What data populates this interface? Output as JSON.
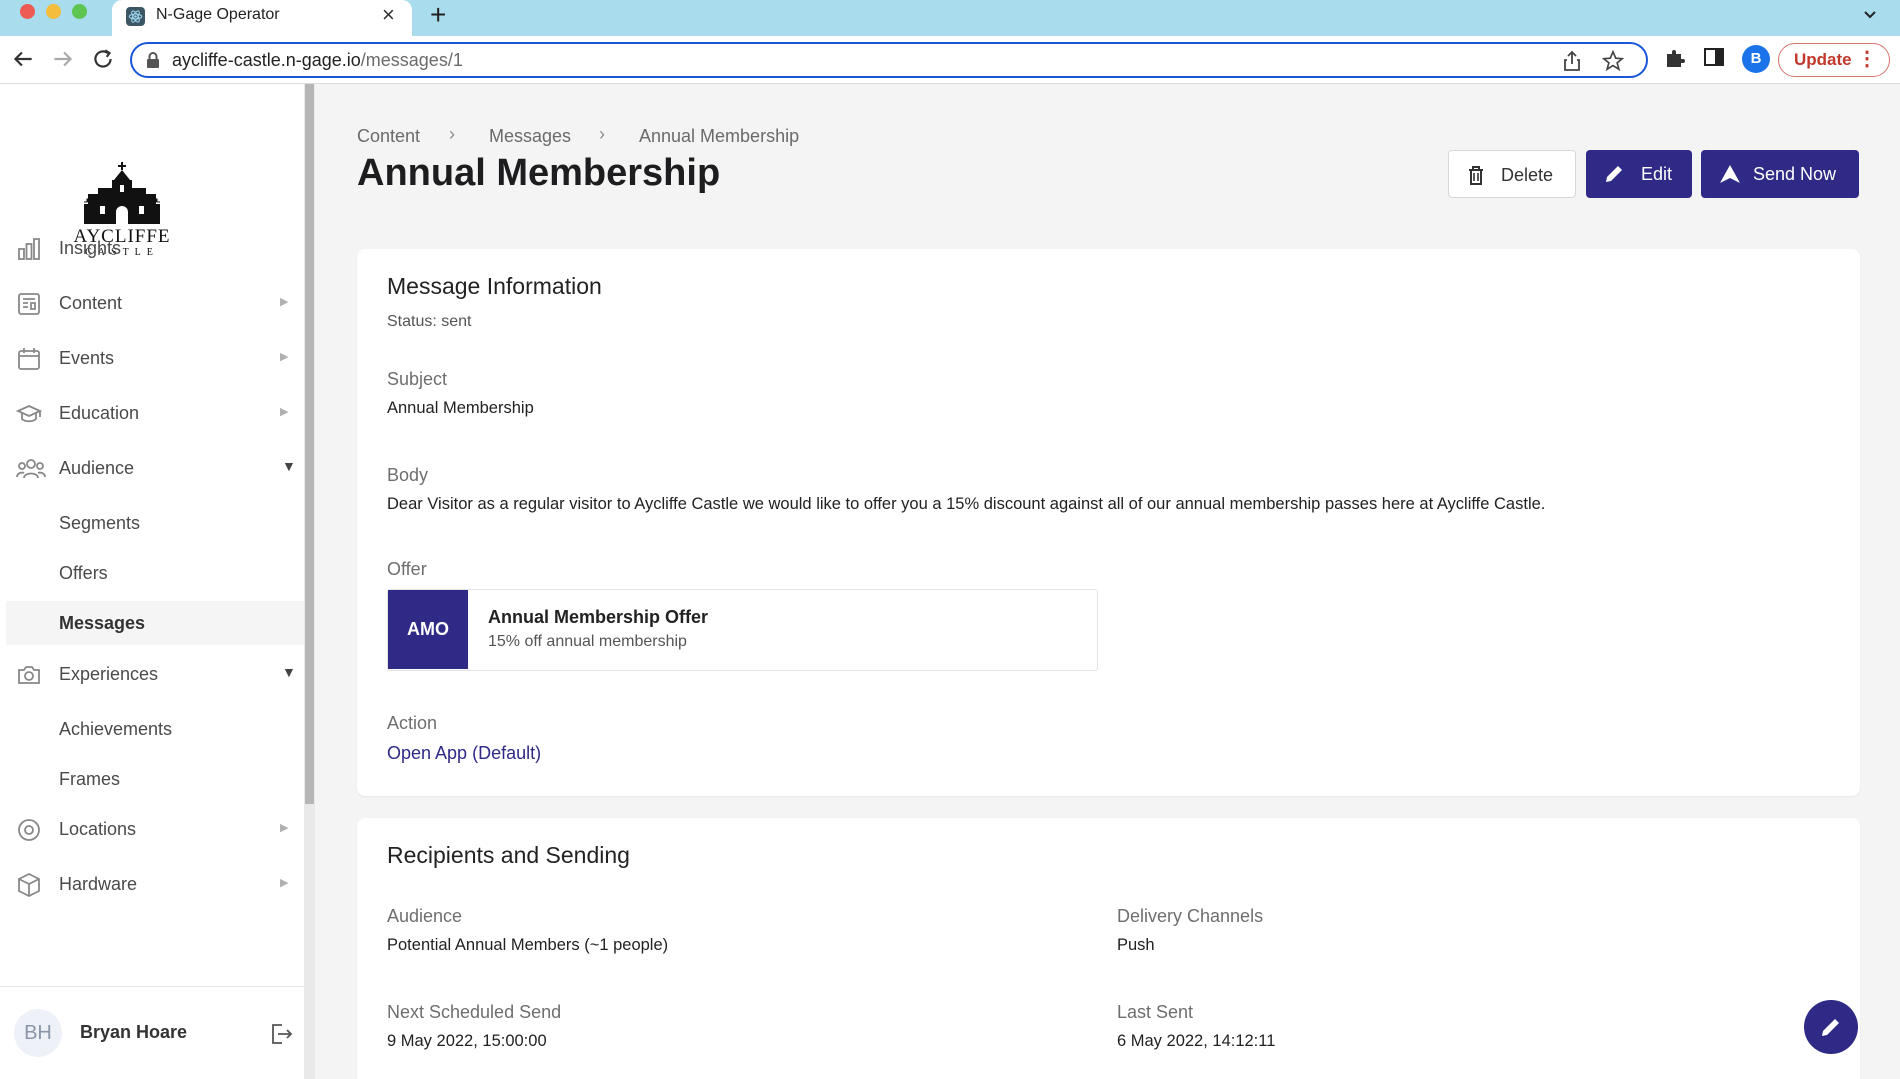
{
  "browser": {
    "tab_title": "N-Gage Operator",
    "tab_close": "×",
    "new_tab": "+",
    "url_host": "aycliffe-castle.n-gage.io",
    "url_path": "/messages/1",
    "profile_initial": "B",
    "update_label": "Update",
    "update_menu": "⋮"
  },
  "sidebar": {
    "logo_text": "AYCLIFFE",
    "logo_sub": "CASTLE",
    "items": [
      {
        "label": "Insights",
        "icon": "bar-chart-icon",
        "arrow": ""
      },
      {
        "label": "Content",
        "icon": "newspaper-icon",
        "arrow": "▶"
      },
      {
        "label": "Events",
        "icon": "calendar-icon",
        "arrow": "▶"
      },
      {
        "label": "Education",
        "icon": "graduation-cap-icon",
        "arrow": "▶"
      },
      {
        "label": "Audience",
        "icon": "users-icon",
        "arrow": "▼"
      },
      {
        "label": "Experiences",
        "icon": "camera-icon",
        "arrow": "▼"
      },
      {
        "label": "Locations",
        "icon": "map-pin-icon",
        "arrow": "▶"
      },
      {
        "label": "Hardware",
        "icon": "box-icon",
        "arrow": "▶"
      }
    ],
    "audience_sub": [
      "Segments",
      "Offers",
      "Messages"
    ],
    "experiences_sub": [
      "Achievements",
      "Frames"
    ],
    "user": {
      "initials": "BH",
      "name": "Bryan Hoare"
    }
  },
  "breadcrumb": [
    "Content",
    "Messages",
    "Annual Membership"
  ],
  "breadcrumb_sep": "›",
  "page_title": "Annual Membership",
  "actions": {
    "delete": "Delete",
    "edit": "Edit",
    "send": "Send Now"
  },
  "message_info": {
    "title": "Message Information",
    "status": "Status: sent",
    "subject_label": "Subject",
    "subject": "Annual Membership",
    "body_label": "Body",
    "body": "Dear Visitor as a regular visitor to Aycliffe Castle we would like to offer you a 15% discount against all of our annual membership passes here at Aycliffe Castle.",
    "offer_label": "Offer",
    "offer": {
      "badge": "AMO",
      "title": "Annual Membership Offer",
      "description": "15% off annual membership"
    },
    "action_label": "Action",
    "action": "Open App (Default)"
  },
  "recipients": {
    "title": "Recipients and Sending",
    "audience_label": "Audience",
    "audience": "Potential Annual Members (~1 people)",
    "channels_label": "Delivery Channels",
    "channels": "Push",
    "next_label": "Next Scheduled Send",
    "next": "9 May 2022, 15:00:00",
    "last_label": "Last Sent",
    "last": "6 May 2022, 14:12:11"
  },
  "colors": {
    "primary": "#2e2a86",
    "tabstrip": "#a9dcec",
    "background": "#f4f4f5"
  }
}
